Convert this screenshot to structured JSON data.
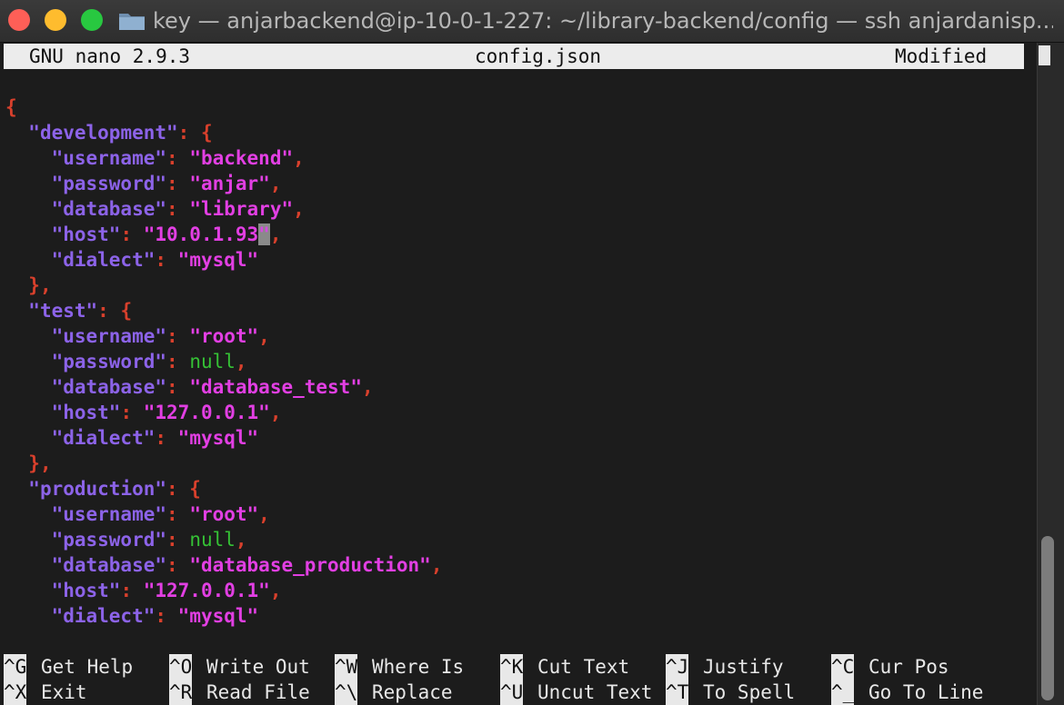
{
  "window": {
    "title": "key — anjarbackend@ip-10-0-1-227: ~/library-backend/config — ssh anjardanisp..."
  },
  "nano": {
    "version": "GNU nano 2.9.3",
    "filename": "config.json",
    "status": "Modified"
  },
  "file": {
    "open_brace": "{",
    "sections": [
      {
        "key": "\"development\"",
        "entries": [
          {
            "key": "\"username\"",
            "value": "\"backend\""
          },
          {
            "key": "\"password\"",
            "value": "\"anjar\""
          },
          {
            "key": "\"database\"",
            "value": "\"library\""
          },
          {
            "key": "\"host\"",
            "value": "\"10.0.1.93",
            "cursor_char": "\""
          },
          {
            "key": "\"dialect\"",
            "value": "\"mysql\""
          }
        ]
      },
      {
        "key": "\"test\"",
        "entries": [
          {
            "key": "\"username\"",
            "value": "\"root\""
          },
          {
            "key": "\"password\"",
            "value": "null"
          },
          {
            "key": "\"database\"",
            "value": "\"database_test\""
          },
          {
            "key": "\"host\"",
            "value": "\"127.0.0.1\""
          },
          {
            "key": "\"dialect\"",
            "value": "\"mysql\""
          }
        ]
      },
      {
        "key": "\"production\"",
        "entries": [
          {
            "key": "\"username\"",
            "value": "\"root\""
          },
          {
            "key": "\"password\"",
            "value": "null"
          },
          {
            "key": "\"database\"",
            "value": "\"database_production\""
          },
          {
            "key": "\"host\"",
            "value": "\"127.0.0.1\""
          },
          {
            "key": "\"dialect\"",
            "value": "\"mysql\""
          }
        ]
      }
    ]
  },
  "shortcuts": [
    {
      "key": "^G",
      "label": "Get Help"
    },
    {
      "key": "^O",
      "label": "Write Out"
    },
    {
      "key": "^W",
      "label": "Where Is"
    },
    {
      "key": "^K",
      "label": "Cut Text"
    },
    {
      "key": "^J",
      "label": "Justify"
    },
    {
      "key": "^C",
      "label": "Cur Pos"
    },
    {
      "key": "^X",
      "label": "Exit"
    },
    {
      "key": "^R",
      "label": "Read File"
    },
    {
      "key": "^\\",
      "label": "Replace"
    },
    {
      "key": "^U",
      "label": "Uncut Text"
    },
    {
      "key": "^T",
      "label": "To Spell"
    },
    {
      "key": "^_",
      "label": "Go To Line"
    }
  ],
  "colors": {
    "json_key": "#8c63e8",
    "json_string": "#e23fe3",
    "json_punctuation": "#d8402c",
    "json_null": "#35c135",
    "terminal_bg": "#1c1c1c"
  }
}
